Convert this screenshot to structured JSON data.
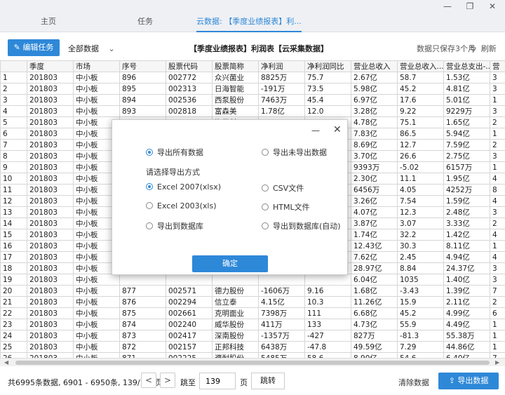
{
  "tabs": [
    {
      "label": "主页"
    },
    {
      "label": "任务"
    },
    {
      "label": "云数据: 【季度业绩报表】利..."
    }
  ],
  "window": {
    "minimize": "—",
    "restore": "❐",
    "close": "✕"
  },
  "toolbar": {
    "edit_task": "编辑任务",
    "scope": "全部数据",
    "title": "【季度业绩报表】利润表【云采集数据】",
    "keep_note": "数据只保存3个月",
    "refresh": "刷新"
  },
  "table": {
    "columns": [
      "",
      "季度",
      "市场",
      "序号",
      "股票代码",
      "股票简称",
      "净利润",
      "净利润同比",
      "营业总收入",
      "营业总收入...",
      "营业总支出-...",
      "营"
    ],
    "rows": [
      [
        "1",
        "201803",
        "中小板",
        "896",
        "002772",
        "众兴菌业",
        "8825万",
        "75.7",
        "2.67亿",
        "58.7",
        "1.53亿",
        "3"
      ],
      [
        "2",
        "201803",
        "中小板",
        "895",
        "002313",
        "日海智能",
        "-191万",
        "73.5",
        "5.98亿",
        "45.2",
        "4.81亿",
        "3"
      ],
      [
        "3",
        "201803",
        "中小板",
        "894",
        "002536",
        "西泵股份",
        "7463万",
        "45.4",
        "6.97亿",
        "17.6",
        "5.01亿",
        "1"
      ],
      [
        "4",
        "201803",
        "中小板",
        "893",
        "002818",
        "富森美",
        "1.78亿",
        "12.0",
        "3.28亿",
        "9.22",
        "9229万",
        "3"
      ],
      [
        "5",
        "201803",
        "中小板",
        "892",
        "002653",
        "海思科",
        "5977万",
        "38.5",
        "4.78亿",
        "75.1",
        "1.65亿",
        "2"
      ],
      [
        "6",
        "201803",
        "中小板",
        "",
        "",
        "",
        "",
        "",
        "7.83亿",
        "86.5",
        "5.94亿",
        "1"
      ],
      [
        "7",
        "201803",
        "中小板",
        "",
        "",
        "",
        "",
        "",
        "8.69亿",
        "12.7",
        "7.59亿",
        "2"
      ],
      [
        "8",
        "201803",
        "中小板",
        "",
        "",
        "",
        "",
        "",
        "3.70亿",
        "26.6",
        "2.75亿",
        "3"
      ],
      [
        "9",
        "201803",
        "中小板",
        "",
        "",
        "",
        "",
        "",
        "9393万",
        "-5.02",
        "6157万",
        "1"
      ],
      [
        "10",
        "201803",
        "中小板",
        "",
        "",
        "",
        "",
        "",
        "2.30亿",
        "11.1",
        "1.95亿",
        "4"
      ],
      [
        "11",
        "201803",
        "中小板",
        "",
        "",
        "",
        "",
        "",
        "6456万",
        "4.05",
        "4252万",
        "8"
      ],
      [
        "12",
        "201803",
        "中小板",
        "",
        "",
        "",
        "",
        "",
        "3.26亿",
        "7.54",
        "1.59亿",
        "4"
      ],
      [
        "13",
        "201803",
        "中小板",
        "",
        "",
        "",
        "",
        "",
        "4.07亿",
        "12.3",
        "2.48亿",
        "3"
      ],
      [
        "14",
        "201803",
        "中小板",
        "",
        "",
        "",
        "",
        "",
        "3.87亿",
        "3.07",
        "3.33亿",
        "2"
      ],
      [
        "15",
        "201803",
        "中小板",
        "",
        "",
        "",
        "",
        "",
        "1.74亿",
        "32.2",
        "1.42亿",
        "4"
      ],
      [
        "16",
        "201803",
        "中小板",
        "",
        "",
        "",
        "",
        "",
        "12.43亿",
        "30.3",
        "8.11亿",
        "1"
      ],
      [
        "17",
        "201803",
        "中小板",
        "",
        "",
        "",
        "",
        "",
        "7.62亿",
        "2.45",
        "4.94亿",
        "4"
      ],
      [
        "18",
        "201803",
        "中小板",
        "",
        "",
        "",
        "",
        "",
        "28.97亿",
        "8.84",
        "24.37亿",
        "3"
      ],
      [
        "19",
        "201803",
        "中小板",
        "",
        "",
        "",
        "",
        "",
        "6.04亿",
        "1035",
        "1.40亿",
        "3"
      ],
      [
        "20",
        "201803",
        "中小板",
        "877",
        "002571",
        "德力股份",
        "-1606万",
        "9.16",
        "1.68亿",
        "-3.43",
        "1.39亿",
        "7"
      ],
      [
        "21",
        "201803",
        "中小板",
        "876",
        "002294",
        "信立泰",
        "4.15亿",
        "10.3",
        "11.26亿",
        "15.9",
        "2.11亿",
        "2"
      ],
      [
        "22",
        "201803",
        "中小板",
        "875",
        "002661",
        "克明面业",
        "7398万",
        "111",
        "6.68亿",
        "45.2",
        "4.99亿",
        "6"
      ],
      [
        "23",
        "201803",
        "中小板",
        "874",
        "002240",
        "威华股份",
        "411万",
        "133",
        "4.73亿",
        "55.9",
        "4.49亿",
        "1"
      ],
      [
        "24",
        "201803",
        "中小板",
        "873",
        "002417",
        "深南股份",
        "-1357万",
        "-427",
        "827万",
        "-81.3",
        "55.38万",
        "1"
      ],
      [
        "25",
        "201803",
        "中小板",
        "872",
        "002157",
        "正邦科技",
        "6438万",
        "-47.8",
        "49.59亿",
        "7.29",
        "44.86亿",
        "1"
      ],
      [
        "26",
        "201803",
        "中小板",
        "871",
        "002225",
        "濮耐股份",
        "5485万",
        "58.6",
        "8.90亿",
        "54.6",
        "6.40亿",
        "7"
      ],
      [
        "27",
        "201803",
        "中小板",
        "870",
        "002667",
        "鞍重股份",
        "929万",
        "7.42",
        "4661万",
        "70.0",
        "3004万",
        "3"
      ]
    ]
  },
  "footer": {
    "page_info": "共6995条数据, 6901 - 6950条, 139/140页",
    "prev": "<",
    "next": ">",
    "jump_label": "跳至",
    "page_value": "139",
    "page_suffix": "页",
    "jump_button": "跳转",
    "clear": "清除数据",
    "export": "导出数据"
  },
  "modal": {
    "minimize": "—",
    "close": "✕",
    "export_all": "导出所有数据",
    "export_unexported": "导出未导出数据",
    "choose_format": "请选择导出方式",
    "fmt_xlsx": "Excel 2007(xlsx)",
    "fmt_csv": "CSV文件",
    "fmt_xls": "Excel 2003(xls)",
    "fmt_html": "HTML文件",
    "fmt_db": "导出到数据库",
    "fmt_db_auto": "导出到数据库(自动)",
    "ok": "确定"
  },
  "colors": {
    "accent": "#2e88d8"
  }
}
